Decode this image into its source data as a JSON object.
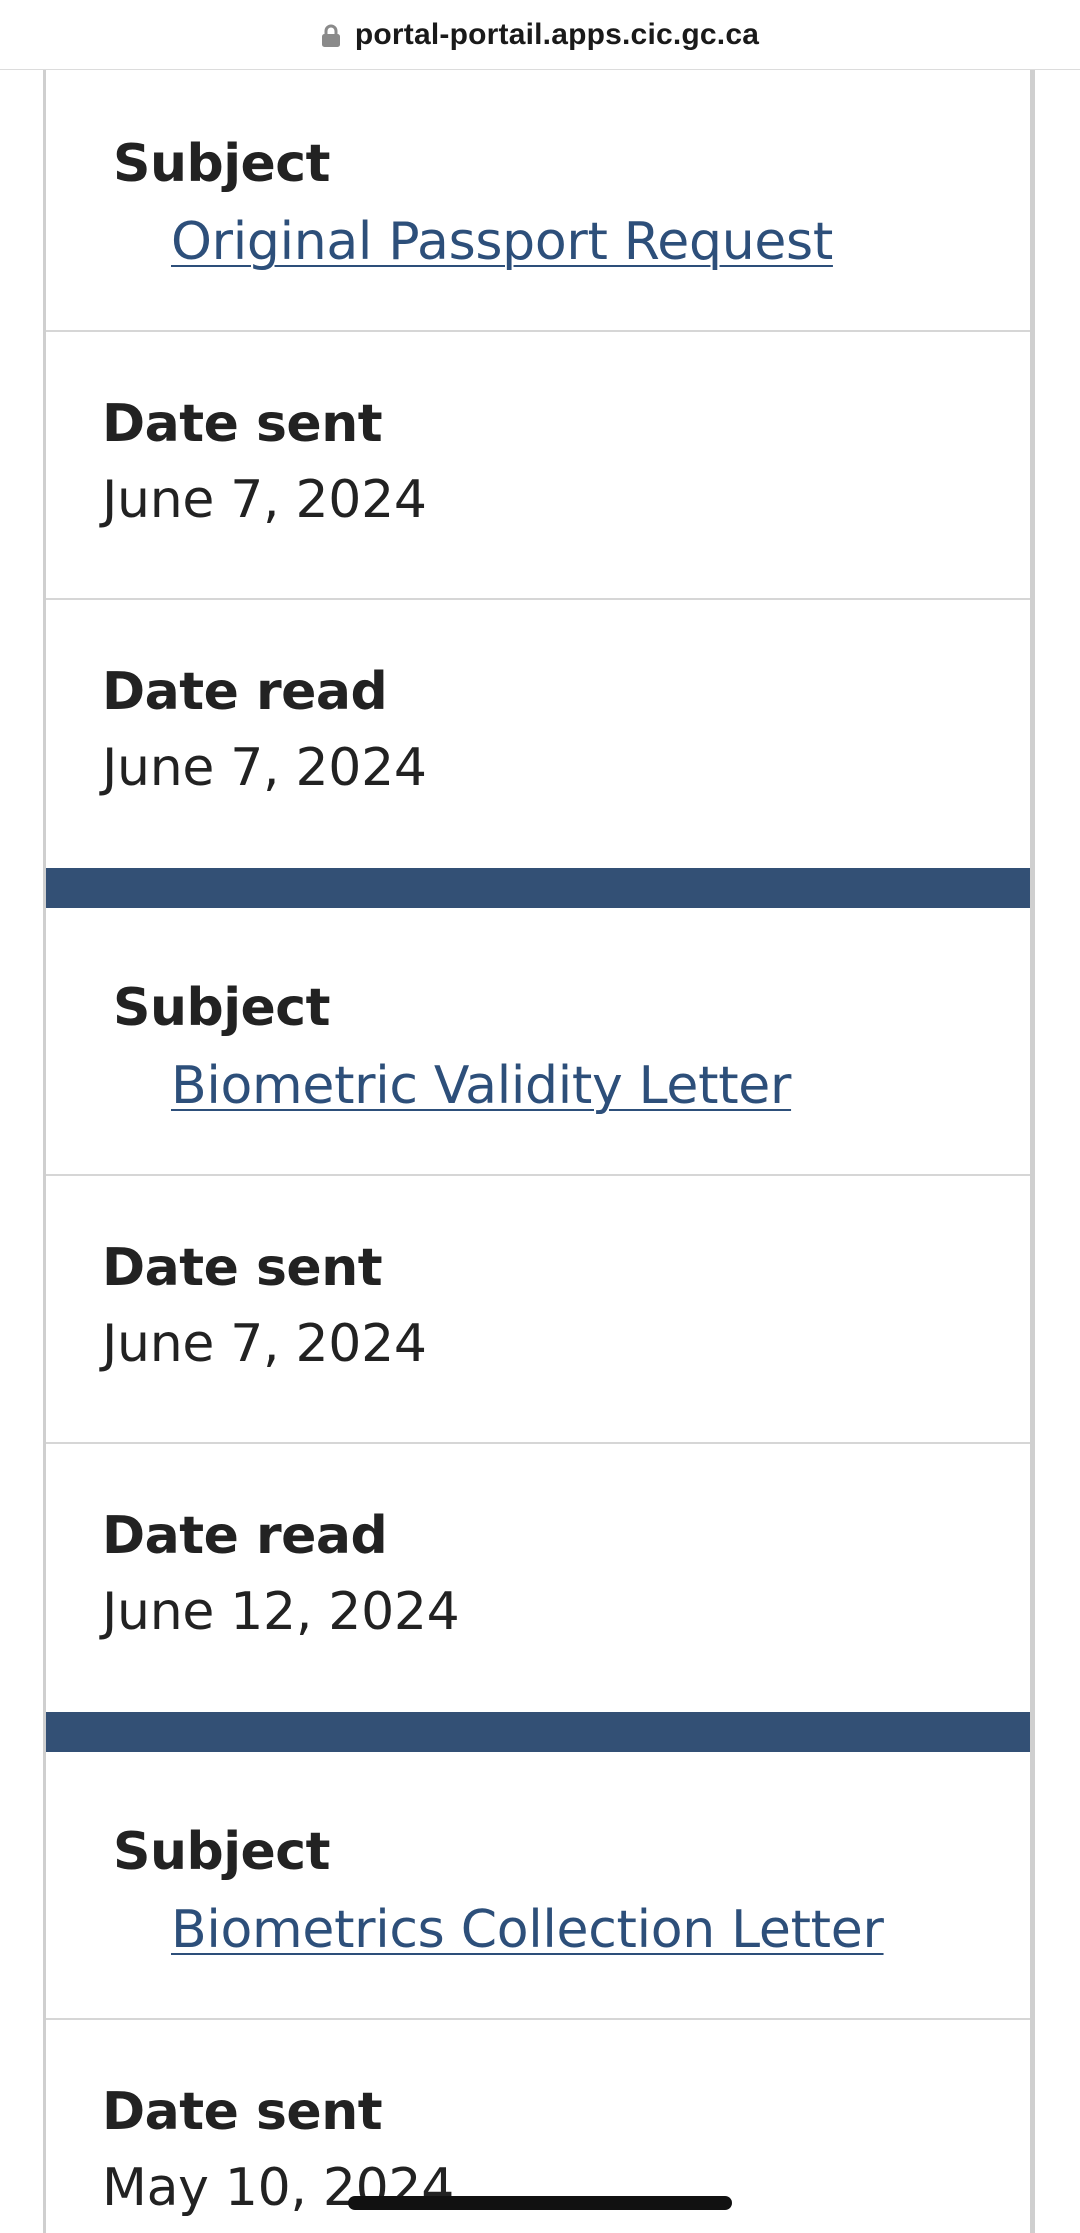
{
  "browser": {
    "url": "portal-portail.apps.cic.gc.ca",
    "lock_icon": "lock-icon"
  },
  "labels": {
    "subject": "Subject",
    "date_sent": "Date sent",
    "date_read": "Date read"
  },
  "messages": [
    {
      "subject": "Original Passport Request",
      "date_sent": "June 7, 2024",
      "date_read": "June 7, 2024"
    },
    {
      "subject": "Biometric Validity Letter",
      "date_sent": "June 7, 2024",
      "date_read": "June 12, 2024"
    },
    {
      "subject": "Biometrics Collection Letter",
      "date_sent": "May 10, 2024"
    }
  ],
  "colors": {
    "divider": "#335075",
    "link": "#2d4f7a",
    "text": "#222222",
    "border": "#cfcfcf"
  }
}
